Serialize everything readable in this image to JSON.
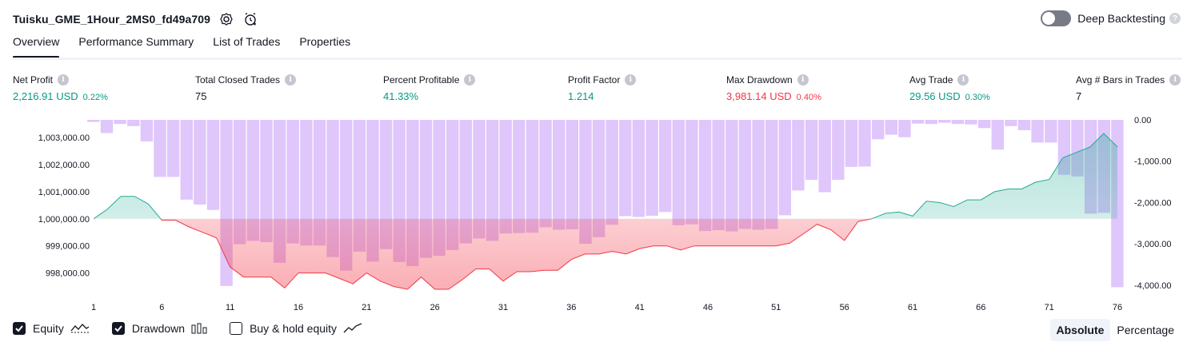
{
  "header": {
    "title": "Tuisku_GME_1Hour_2MS0_fd49a709",
    "deep_backtesting_label": "Deep Backtesting",
    "help": "?"
  },
  "tabs": [
    {
      "label": "Overview",
      "active": true
    },
    {
      "label": "Performance Summary"
    },
    {
      "label": "List of Trades"
    },
    {
      "label": "Properties"
    }
  ],
  "metrics": [
    {
      "label": "Net Profit",
      "value": "2,216.91 USD",
      "pct": "0.22%",
      "color": "green"
    },
    {
      "label": "Total Closed Trades",
      "value": "75",
      "pct": "",
      "color": "dark"
    },
    {
      "label": "Percent Profitable",
      "value": "41.33%",
      "pct": "",
      "color": "green"
    },
    {
      "label": "Profit Factor",
      "value": "1.214",
      "pct": "",
      "color": "green"
    },
    {
      "label": "Max Drawdown",
      "value": "3,981.14 USD",
      "pct": "0.40%",
      "color": "red"
    },
    {
      "label": "Avg Trade",
      "value": "29.56 USD",
      "pct": "0.30%",
      "color": "green"
    },
    {
      "label": "Avg # Bars in Trades",
      "value": "7",
      "pct": "",
      "color": "dark"
    }
  ],
  "info_glyph": "i",
  "chart_data": {
    "type": "line+bar",
    "x_ticks": [
      "1",
      "6",
      "11",
      "16",
      "21",
      "26",
      "31",
      "36",
      "41",
      "46",
      "51",
      "56",
      "61",
      "66",
      "71",
      "76"
    ],
    "left_axis": {
      "ticks": [
        "1,003,000.00",
        "1,002,000.00",
        "1,001,000.00",
        "1,000,000.00",
        "999,000.00",
        "998,000.00"
      ],
      "range": [
        997400,
        1003650
      ]
    },
    "right_axis": {
      "ticks": [
        "0.00",
        "-1,000.00",
        "-2,000.00",
        "-3,000.00",
        "-4,000.00"
      ],
      "range": [
        -4100,
        0
      ]
    },
    "baseline": 1000000,
    "equity_series": {
      "name": "Equity",
      "x": [
        1,
        2,
        3,
        4,
        5,
        6,
        7,
        8,
        9,
        10,
        11,
        12,
        13,
        14,
        15,
        16,
        17,
        18,
        19,
        20,
        21,
        22,
        23,
        24,
        25,
        26,
        27,
        28,
        29,
        30,
        31,
        32,
        33,
        34,
        35,
        36,
        37,
        38,
        39,
        40,
        41,
        42,
        43,
        44,
        45,
        46,
        47,
        48,
        49,
        50,
        51,
        52,
        53,
        54,
        55,
        56,
        57,
        58,
        59,
        60,
        61,
        62,
        63,
        64,
        65,
        66,
        67,
        68,
        69,
        70,
        71,
        72,
        73,
        74,
        75,
        76
      ],
      "values": [
        1000000,
        1000350,
        1000830,
        1000830,
        1000550,
        999950,
        999950,
        999700,
        999500,
        999300,
        998220,
        997850,
        997850,
        997850,
        997450,
        998000,
        998000,
        998000,
        997800,
        997600,
        998000,
        997700,
        997500,
        997400,
        997850,
        997400,
        997400,
        997750,
        998150,
        998150,
        997700,
        998050,
        998050,
        998100,
        998100,
        998500,
        998700,
        998700,
        998800,
        998700,
        998900,
        999000,
        999000,
        998850,
        999000,
        999000,
        999000,
        999000,
        999000,
        999000,
        999000,
        999100,
        999450,
        999800,
        999600,
        999200,
        999900,
        1000000,
        1000200,
        1000250,
        1000100,
        1000650,
        1000600,
        1000450,
        1000700,
        1000700,
        1001000,
        1001100,
        1001100,
        1001350,
        1001450,
        1002250,
        1002450,
        1002650,
        1003150,
        1002650
      ]
    },
    "drawdown_series": {
      "name": "Drawdown",
      "values": [
        -50,
        -320,
        -100,
        -150,
        -520,
        -1380,
        -1380,
        -1930,
        -2050,
        -2180,
        -4020,
        -3010,
        -2930,
        -2960,
        -3460,
        -2990,
        -3040,
        -3040,
        -3320,
        -3650,
        -3190,
        -3430,
        -3130,
        -3440,
        -3540,
        -3340,
        -3290,
        -3150,
        -2990,
        -2870,
        -2930,
        -2750,
        -2740,
        -2730,
        -2600,
        -2660,
        -2650,
        -3000,
        -2840,
        -2540,
        -2330,
        -2350,
        -2320,
        -2230,
        -2550,
        -2530,
        -2690,
        -2670,
        -2700,
        -2640,
        -2660,
        -2640,
        -2310,
        -1710,
        -1450,
        -1750,
        -1450,
        -1140,
        -1130,
        -470,
        -360,
        -420,
        -90,
        -100,
        -70,
        -100,
        -110,
        -200,
        -720,
        -150,
        -250,
        -550,
        -550,
        -1330,
        -1370,
        -2270,
        -2250,
        -4050
      ]
    },
    "legend": [
      "Equity",
      "Drawdown",
      "Buy & hold equity"
    ]
  },
  "legend": {
    "equity": {
      "label": "Equity",
      "checked": true
    },
    "drawdown": {
      "label": "Drawdown",
      "checked": true
    },
    "buyhold": {
      "label": "Buy & hold equity",
      "checked": false
    }
  },
  "modes": [
    {
      "label": "Absolute",
      "active": true
    },
    {
      "label": "Percentage",
      "active": false
    }
  ],
  "colors": {
    "equity_line": "#22ab94",
    "equity_fill": "#d7f0ea",
    "loss_line": "#f23645",
    "loss_fill": "#f9c9cd",
    "drawdown_bar": "#dcc0fb",
    "axis_text": "#131722"
  }
}
